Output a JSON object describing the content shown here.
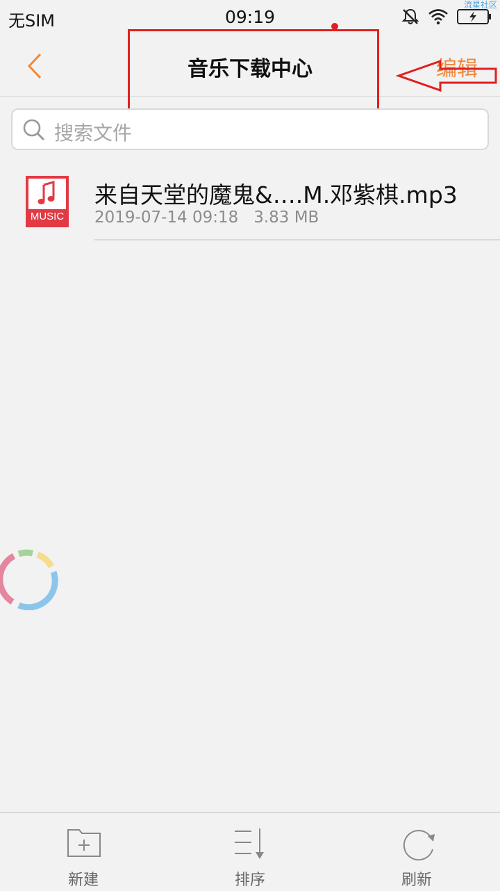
{
  "status_bar": {
    "carrier": "无SIM",
    "time": "09:19",
    "watermark": "流星社区",
    "icons": [
      "mute-icon",
      "wifi-icon",
      "battery-charging-icon"
    ]
  },
  "nav": {
    "title": "音乐下载中心",
    "edit_label": "编辑",
    "back_icon": "chevron-left-icon"
  },
  "search": {
    "placeholder": "搜索文件",
    "icon": "search-icon"
  },
  "files": [
    {
      "name": "来自天堂的魔鬼&….M.邓紫棋.mp3",
      "meta": "2019-07-14 09:18   3.83 MB",
      "icon_label": "MUSIC"
    }
  ],
  "toolbar": {
    "new_label": "新建",
    "sort_label": "排序",
    "refresh_label": "刷新"
  },
  "colors": {
    "accent": "#f0883a",
    "annotation": "#e02020",
    "music_icon": "#e23a45",
    "background": "#f2f2f2"
  }
}
